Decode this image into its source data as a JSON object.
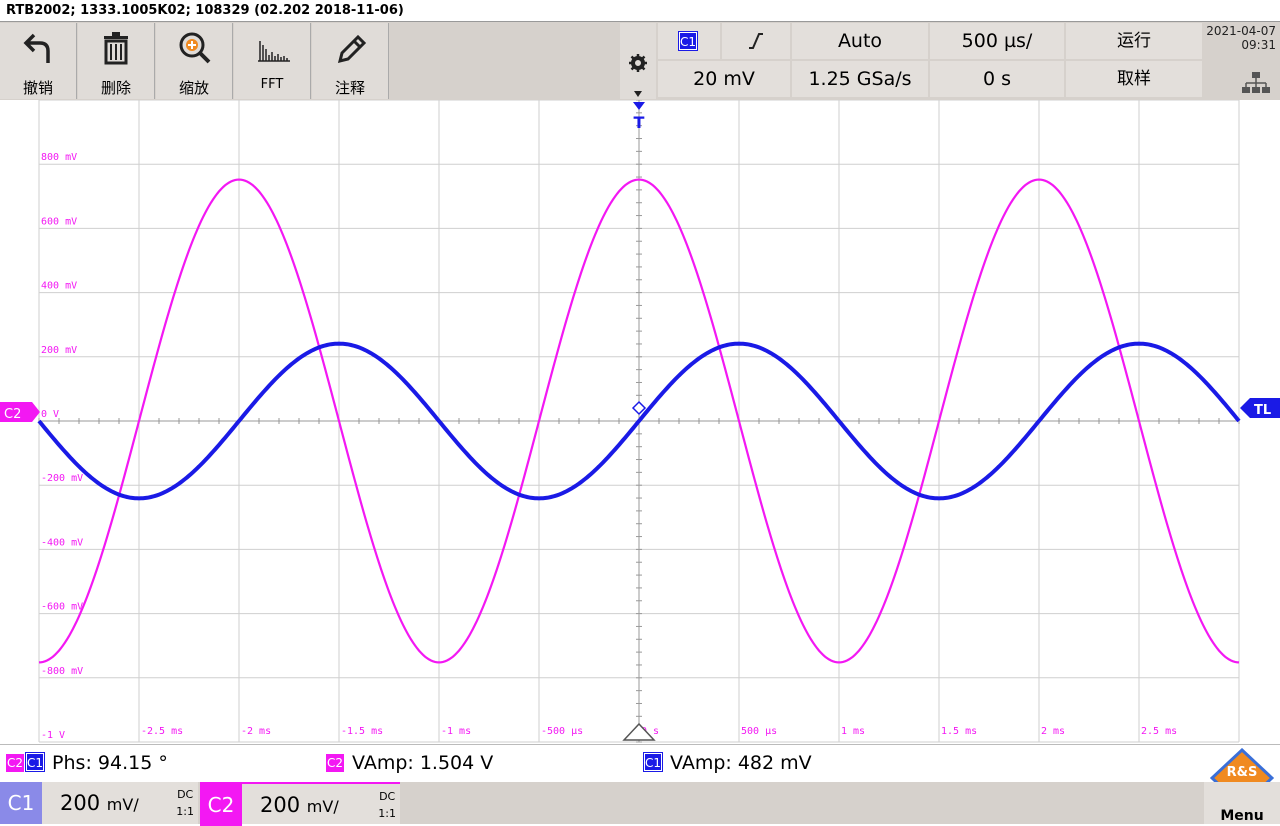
{
  "title": "RTB2002; 1333.1005K02; 108329 (02.202 2018-11-06)",
  "toolbar": {
    "undo": "撤销",
    "delete": "删除",
    "zoom": "缩放",
    "fft": "FFT",
    "annotate": "注释"
  },
  "settings": {
    "trigger_source": "C1",
    "trigger_slope": "rising-edge-icon",
    "trigger_mode": "Auto",
    "timebase": "500 µs/",
    "run_state": "运行",
    "trigger_level": "20 mV",
    "sample_rate": "1.25 GSa/s",
    "time_offset": "0 s",
    "acquire": "取样"
  },
  "datetime": {
    "date": "2021-04-07",
    "time": "09:31"
  },
  "screen": {
    "trigger_marker": "T",
    "trigger_level_marker": "TL",
    "ch2_marker": "C2",
    "y_labels": [
      "800 mV",
      "600 mV",
      "400 mV",
      "200 mV",
      "0 V",
      "-200 mV",
      "-400 mV",
      "-600 mV",
      "-800 mV",
      "-1 V"
    ],
    "x_labels": [
      "-2.5 ms",
      "-2 ms",
      "-1.5 ms",
      "-1 ms",
      "-500 µs",
      "0 s",
      "500 µs",
      "1 ms",
      "1.5 ms",
      "2 ms",
      "2.5 ms"
    ]
  },
  "chart_data": {
    "type": "line",
    "xlabel": "",
    "ylabel": "",
    "xlim": [
      -3,
      3
    ],
    "xunit": "ms",
    "ylim": [
      -1,
      1
    ],
    "yunit": "V",
    "grid": true,
    "series": [
      {
        "name": "C1",
        "color": "#1a1ae6",
        "period_ms": 2,
        "amplitude_V": 0.241,
        "phase_note": "zero crossing rising at 0 s",
        "kind": "sine"
      },
      {
        "name": "C2",
        "color": "#f318f3",
        "period_ms": 2,
        "amplitude_V": 0.752,
        "peak_at_ms": 0,
        "kind": "sine"
      }
    ]
  },
  "measurements": {
    "m1_sources": [
      "C2",
      "C1"
    ],
    "m1": "Phs: 94.15 °",
    "m2_source": "C2",
    "m2": "VAmp: 1.504 V",
    "m3_source": "C1",
    "m3": "VAmp: 482 mV"
  },
  "channels": [
    {
      "label": "C1",
      "scale_num": "200",
      "scale_unit": "mV/",
      "coupling": "DC",
      "probe": "1:1",
      "color": "#8a8ae8"
    },
    {
      "label": "C2",
      "scale_num": "200",
      "scale_unit": "mV/",
      "coupling": "DC",
      "probe": "1:1",
      "color": "#f318f3"
    }
  ],
  "menu": {
    "label": "Menu",
    "logo_text": "R&S"
  },
  "colors": {
    "ch1": "#1a1ae6",
    "ch2": "#f318f3",
    "grid": "#c8c8c8",
    "toolbar": "#d6d1cc"
  }
}
